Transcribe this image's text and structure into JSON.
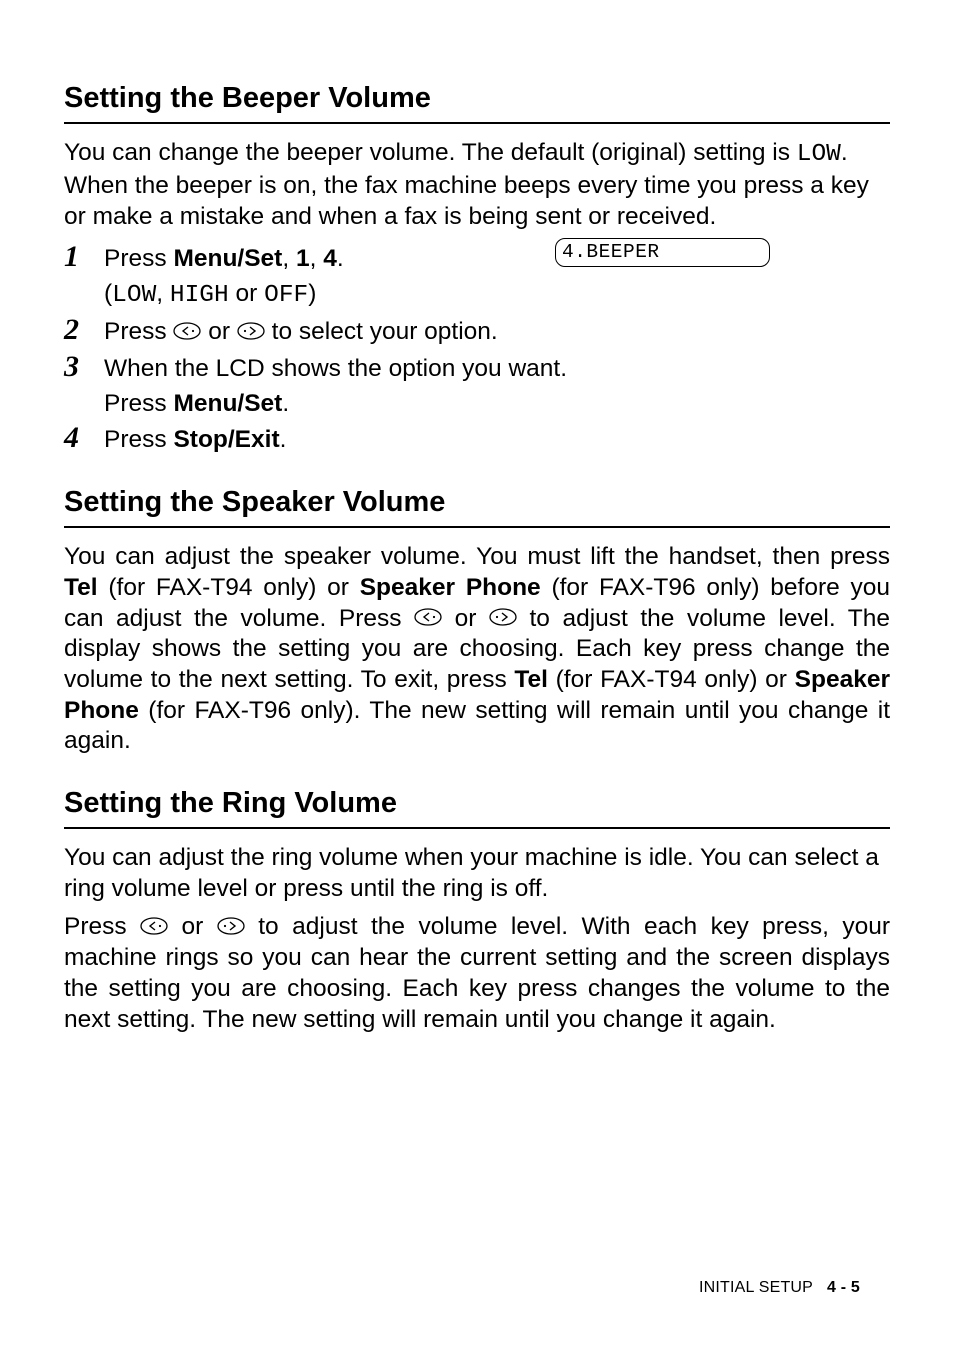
{
  "sectionA": {
    "title": "Setting the Beeper Volume",
    "intro_pre": "You can change the beeper volume. The default (original) setting is ",
    "intro_low": "LOW",
    "intro_post": ". When the beeper is on, the fax machine beeps every time you press a key or make a mistake and when a fax is being sent or received.",
    "lcd": "4.BEEPER",
    "step1_a": "Press ",
    "step1_b": "Menu/Set",
    "step1_c": ", ",
    "step1_d": "1",
    "step1_e": ", ",
    "step1_f": "4",
    "step1_g": ".",
    "step1_sub_a": "(",
    "step1_sub_b": "LOW",
    "step1_sub_c": ", ",
    "step1_sub_d": "HIGH",
    "step1_sub_e": " or ",
    "step1_sub_f": "OFF",
    "step1_sub_g": ")",
    "step2_a": "Press ",
    "step2_b": " or ",
    "step2_c": " to select your option.",
    "step3_a": "When the LCD shows the option you want.",
    "step3_sub_a": "Press ",
    "step3_sub_b": "Menu/Set",
    "step3_sub_c": ".",
    "step4_a": "Press ",
    "step4_b": "Stop/Exit",
    "step4_c": "."
  },
  "sectionB": {
    "title": "Setting the Speaker Volume",
    "p1_a": "You can adjust the speaker volume. You must lift the handset, then press ",
    "p1_b": "Tel",
    "p1_c": " (for FAX-T94 only) or ",
    "p1_d": "Speaker Phone",
    "p1_e": " (for FAX-T96 only) before you can adjust the volume. Press ",
    "p1_f": " or ",
    "p1_g": " to adjust the volume level. The display shows the setting you are choosing. Each key press change the volume to the next setting. To exit, press ",
    "p1_h": "Tel",
    "p1_i": " (for FAX-T94 only) or ",
    "p1_j": "Speaker Phone",
    "p1_k": " (for FAX-T96 only). The new setting will remain until you change it again."
  },
  "sectionC": {
    "title": "Setting the Ring Volume",
    "p1": "You can adjust the ring volume when your machine is idle. You can select a ring volume level or press until the ring is off.",
    "p2_a": "Press ",
    "p2_b": " or ",
    "p2_c": " to adjust the volume level. With each key press, your machine rings so you can hear the current setting and the screen displays the setting you are choosing. Each key press changes the volume to the next setting. The new setting will remain until you change it again."
  },
  "footer": {
    "chapter": "INITIAL SETUP",
    "page": "4 - 5"
  }
}
